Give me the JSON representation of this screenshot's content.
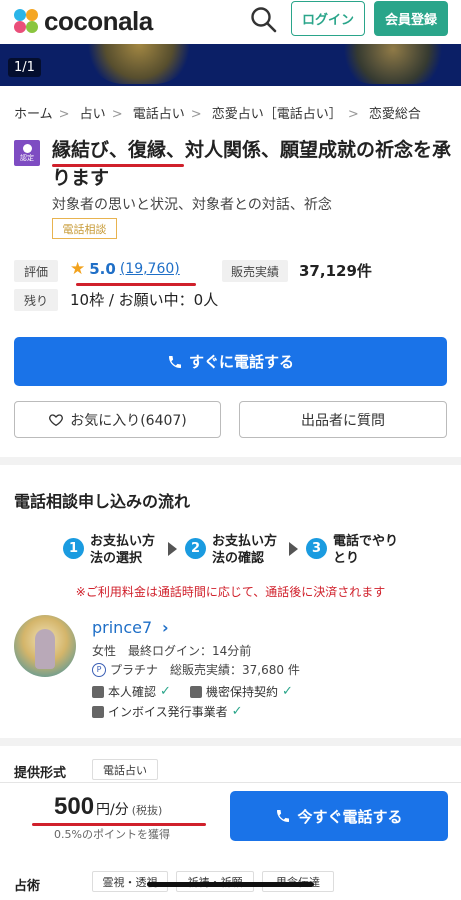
{
  "header": {
    "logo_text": "coconala",
    "login_label": "ログイン",
    "register_label": "会員登録",
    "brand_color": "#2aa58a"
  },
  "hero": {
    "counter": "1/1"
  },
  "breadcrumb": [
    "ホーム",
    "占い",
    "電話占い",
    "恋愛占い［電話占い］",
    "恋愛総合"
  ],
  "service": {
    "badge": "認定",
    "title": "縁結び、復縁、対人関係、願望成就の祈念を承ります",
    "subtitle": "対象者の思いと状況、対象者との対話、祈念",
    "tag": "電話相談"
  },
  "stats": {
    "rating_label": "評価",
    "rating_score": "5.0",
    "rating_count": "(19,760)",
    "sales_label": "販売実績",
    "sales_value": "37,129件",
    "slots_label": "残り",
    "slots_value": "10枠 / お願い中：0人"
  },
  "actions": {
    "call_main": "すぐに電話する",
    "favorite": "お気に入り(6407)",
    "question": "出品者に質問"
  },
  "flow": {
    "title": "電話相談申し込みの流れ",
    "steps": [
      {
        "num": "1",
        "line1": "お支払い方",
        "line2": "法の選択"
      },
      {
        "num": "2",
        "line1": "お支払い方",
        "line2": "法の確認"
      },
      {
        "num": "3",
        "line1": "電話でやり",
        "line2": "とり"
      }
    ],
    "notice": "※ご利用料金は通話時間に応じて、通話後に決済されます"
  },
  "seller": {
    "name": "prince7",
    "meta": "女性　最終ログイン：14分前",
    "rank": "プラチナ",
    "total_sales": "総販売実績：37,680 件",
    "verify_id": "本人確認",
    "verify_nda": "機密保持契約",
    "verify_invoice": "インボイス発行事業者"
  },
  "offer": {
    "label": "提供形式",
    "tag": "電話占い"
  },
  "price": {
    "amount": "500",
    "unit": "円/分",
    "tax": "(税抜)",
    "point": "0.5%のポイントを獲得",
    "call_now": "今すぐ電話する"
  },
  "divination": {
    "label": "占術",
    "tags": [
      "霊視・透視",
      "祈祷・祈願",
      "思念伝達"
    ]
  }
}
